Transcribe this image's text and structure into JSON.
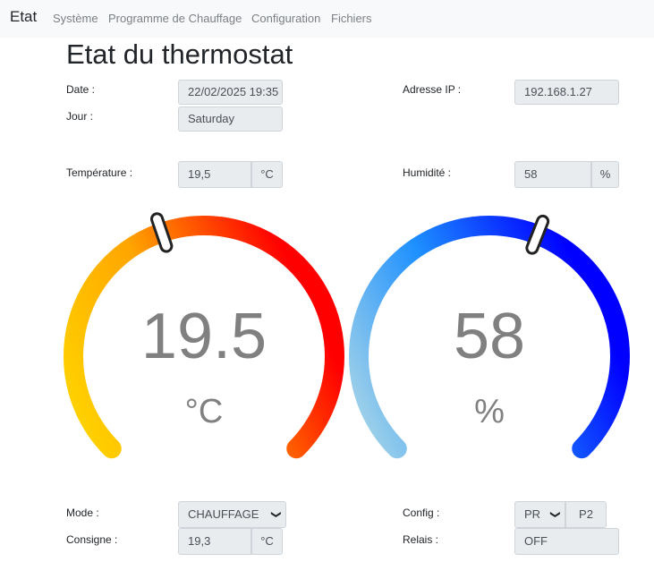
{
  "nav": {
    "brand": "Etat",
    "items": [
      "Système",
      "Programme de Chauffage",
      "Configuration",
      "Fichiers"
    ]
  },
  "title": "Etat du thermostat",
  "date": {
    "label": "Date :",
    "value": "22/02/2025 19:35"
  },
  "jour": {
    "label": "Jour :",
    "value": "Saturday"
  },
  "ip": {
    "label": "Adresse IP :",
    "value": "192.168.1.27"
  },
  "temperature": {
    "label": "Température :",
    "value": "19,5",
    "unit": "°C"
  },
  "humidite": {
    "label": "Humidité :",
    "value": "58",
    "unit": "%"
  },
  "gauge_temp": {
    "value": "19.5",
    "unit": "°C",
    "fraction": 0.43,
    "colors": [
      "#ffd700",
      "#ffa500",
      "#ff0000"
    ]
  },
  "gauge_hum": {
    "value": "58",
    "unit": "%",
    "fraction": 0.58,
    "colors": [
      "#add8e6",
      "#1e90ff",
      "#0000ff"
    ]
  },
  "mode": {
    "label": "Mode :",
    "value": "CHAUFFAGE"
  },
  "consigne": {
    "label": "Consigne :",
    "value": "19,3",
    "unit": "°C"
  },
  "config": {
    "label": "Config :",
    "value": "PR",
    "program": "P2"
  },
  "relais": {
    "label": "Relais :",
    "value": "OFF"
  }
}
